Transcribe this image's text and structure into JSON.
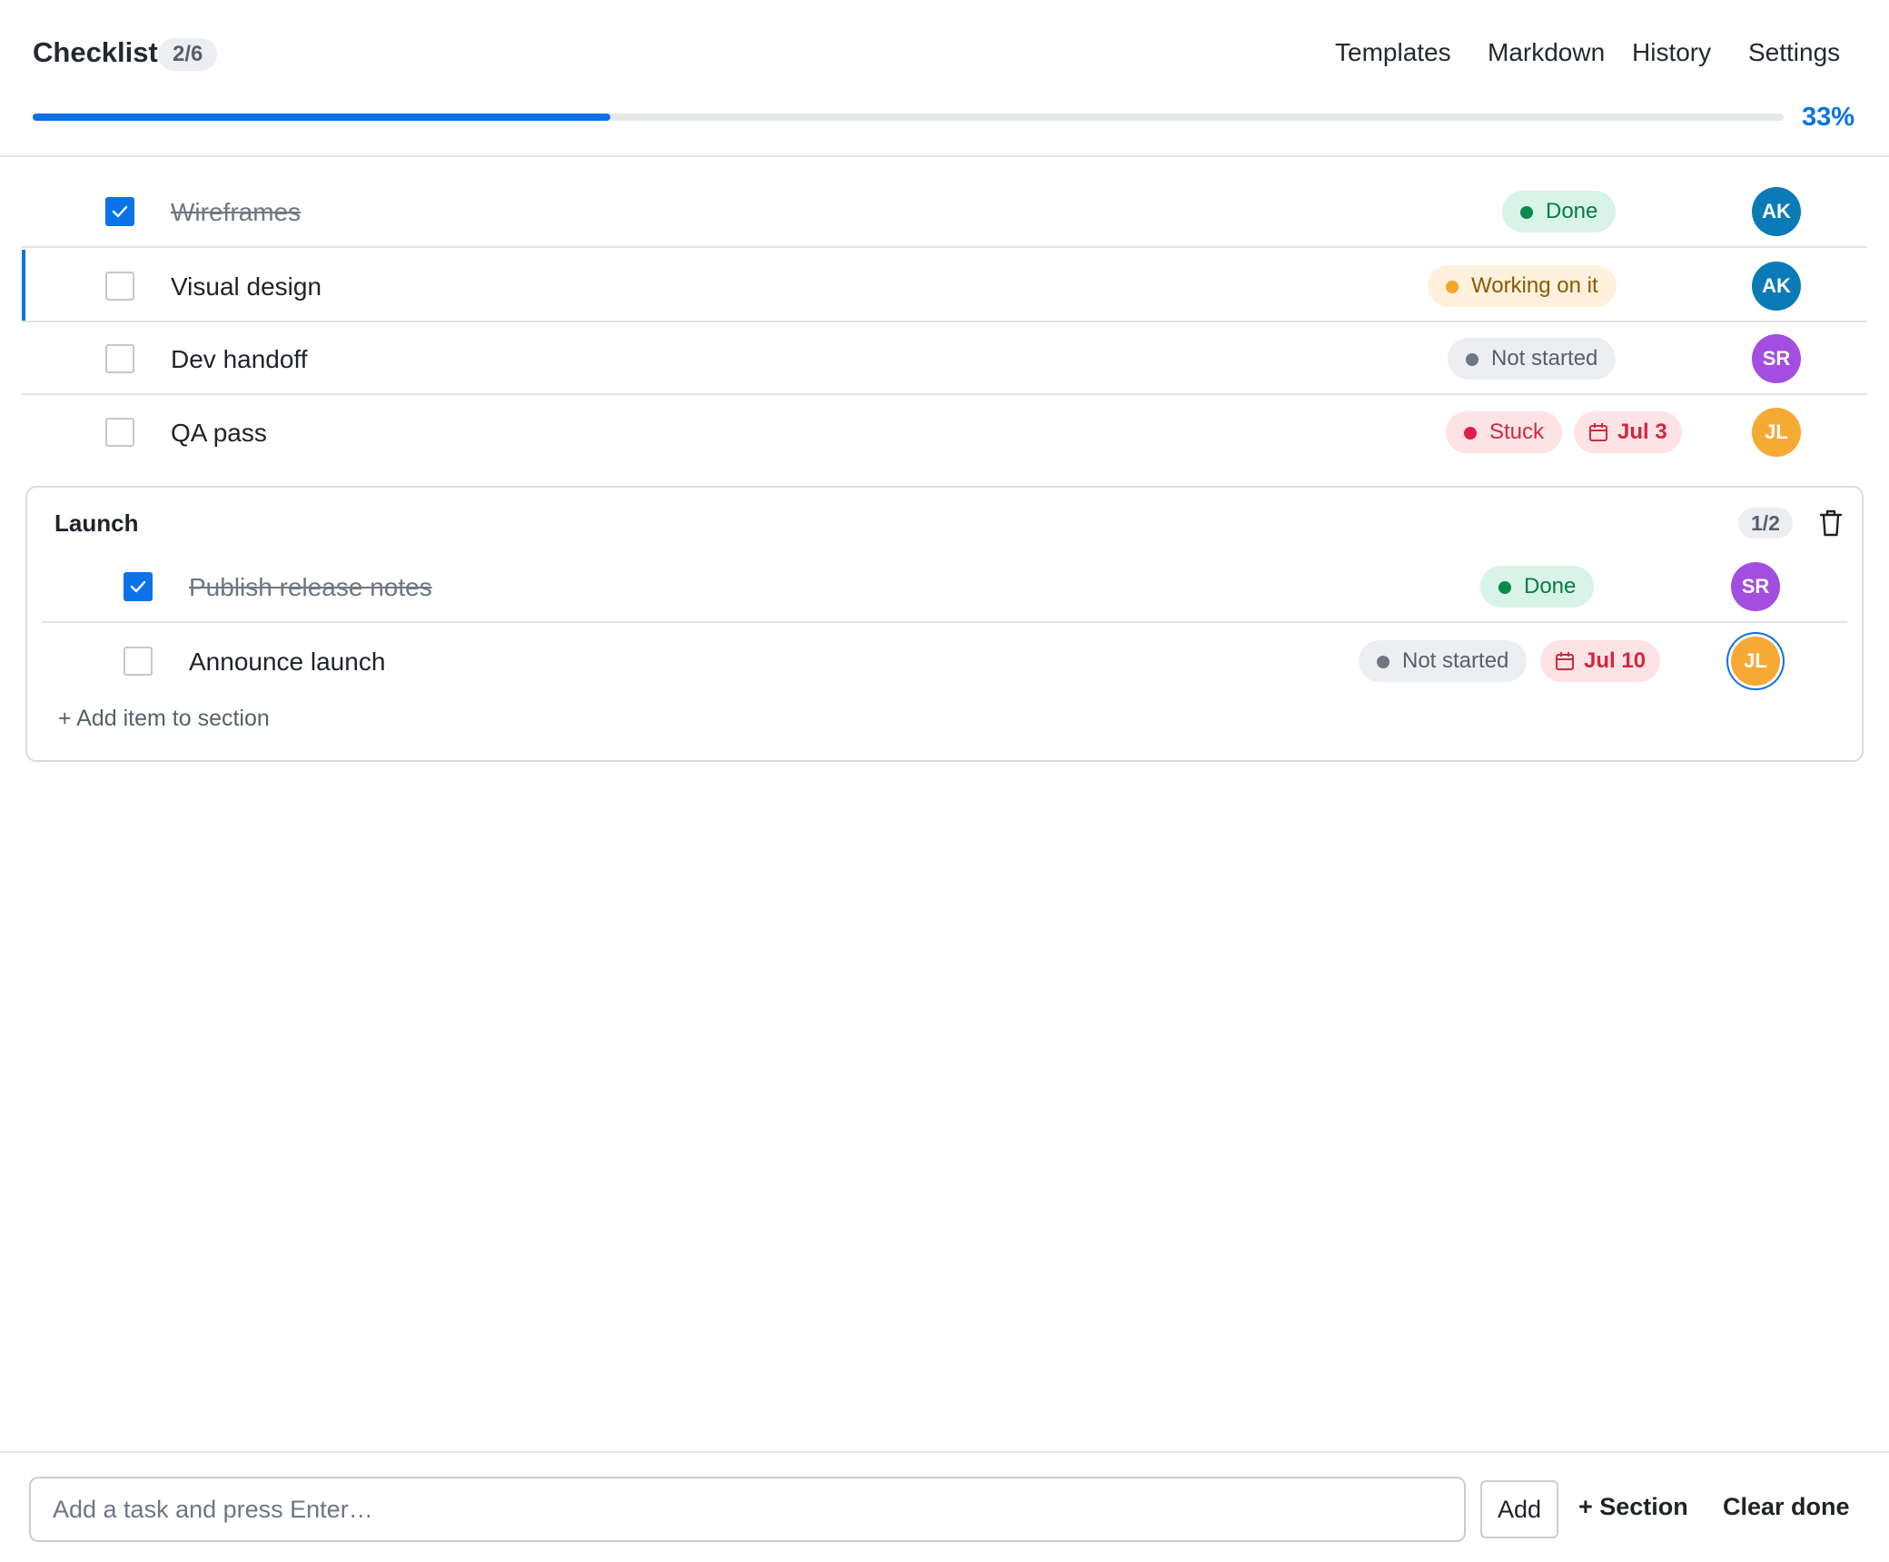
{
  "header": {
    "title": "Checklist",
    "count": "2/6",
    "nav": [
      "Templates",
      "Markdown",
      "History",
      "Settings"
    ],
    "progress_percent": 33,
    "progress_label": "33%"
  },
  "items": [
    {
      "text": "Wireframes",
      "checked": true,
      "status": "Done",
      "due": "",
      "avatar": "AK",
      "avatar_color": "#0a7bb6"
    },
    {
      "text": "Visual design",
      "checked": false,
      "status": "Working on it",
      "due": "",
      "avatar": "AK",
      "avatar_color": "#0a7bb6"
    },
    {
      "text": "Dev handoff",
      "checked": false,
      "status": "Not started",
      "due": "",
      "avatar": "SR",
      "avatar_color": "#a34ee0"
    },
    {
      "text": "QA pass",
      "checked": false,
      "status": "Stuck",
      "due": "Jul 3",
      "avatar": "JL",
      "avatar_color": "#f7a935"
    }
  ],
  "section": {
    "title": "Launch",
    "count": "1/2",
    "items": [
      {
        "text": "Publish release notes",
        "checked": true,
        "status": "Done",
        "due": "",
        "avatar": "SR",
        "avatar_color": "#a34ee0"
      },
      {
        "text": "Announce launch",
        "checked": false,
        "status": "Not started",
        "due": "Jul 10",
        "avatar": "JL",
        "avatar_color": "#f7a935"
      }
    ],
    "add_label": "+ Add item to section"
  },
  "footer": {
    "input_placeholder": "Add a task and press Enter…",
    "add_label": "Add",
    "section_label": "+ Section",
    "clear_label": "Clear done"
  },
  "colors": {
    "accent": "#0b72e7",
    "done": "#0a8a4a",
    "working": "#f5a623",
    "not_started": "#6e7781",
    "stuck": "#e11d48"
  },
  "icons": {
    "checkbox": "check-icon",
    "date": "calendar-icon",
    "delete": "trash-icon"
  }
}
